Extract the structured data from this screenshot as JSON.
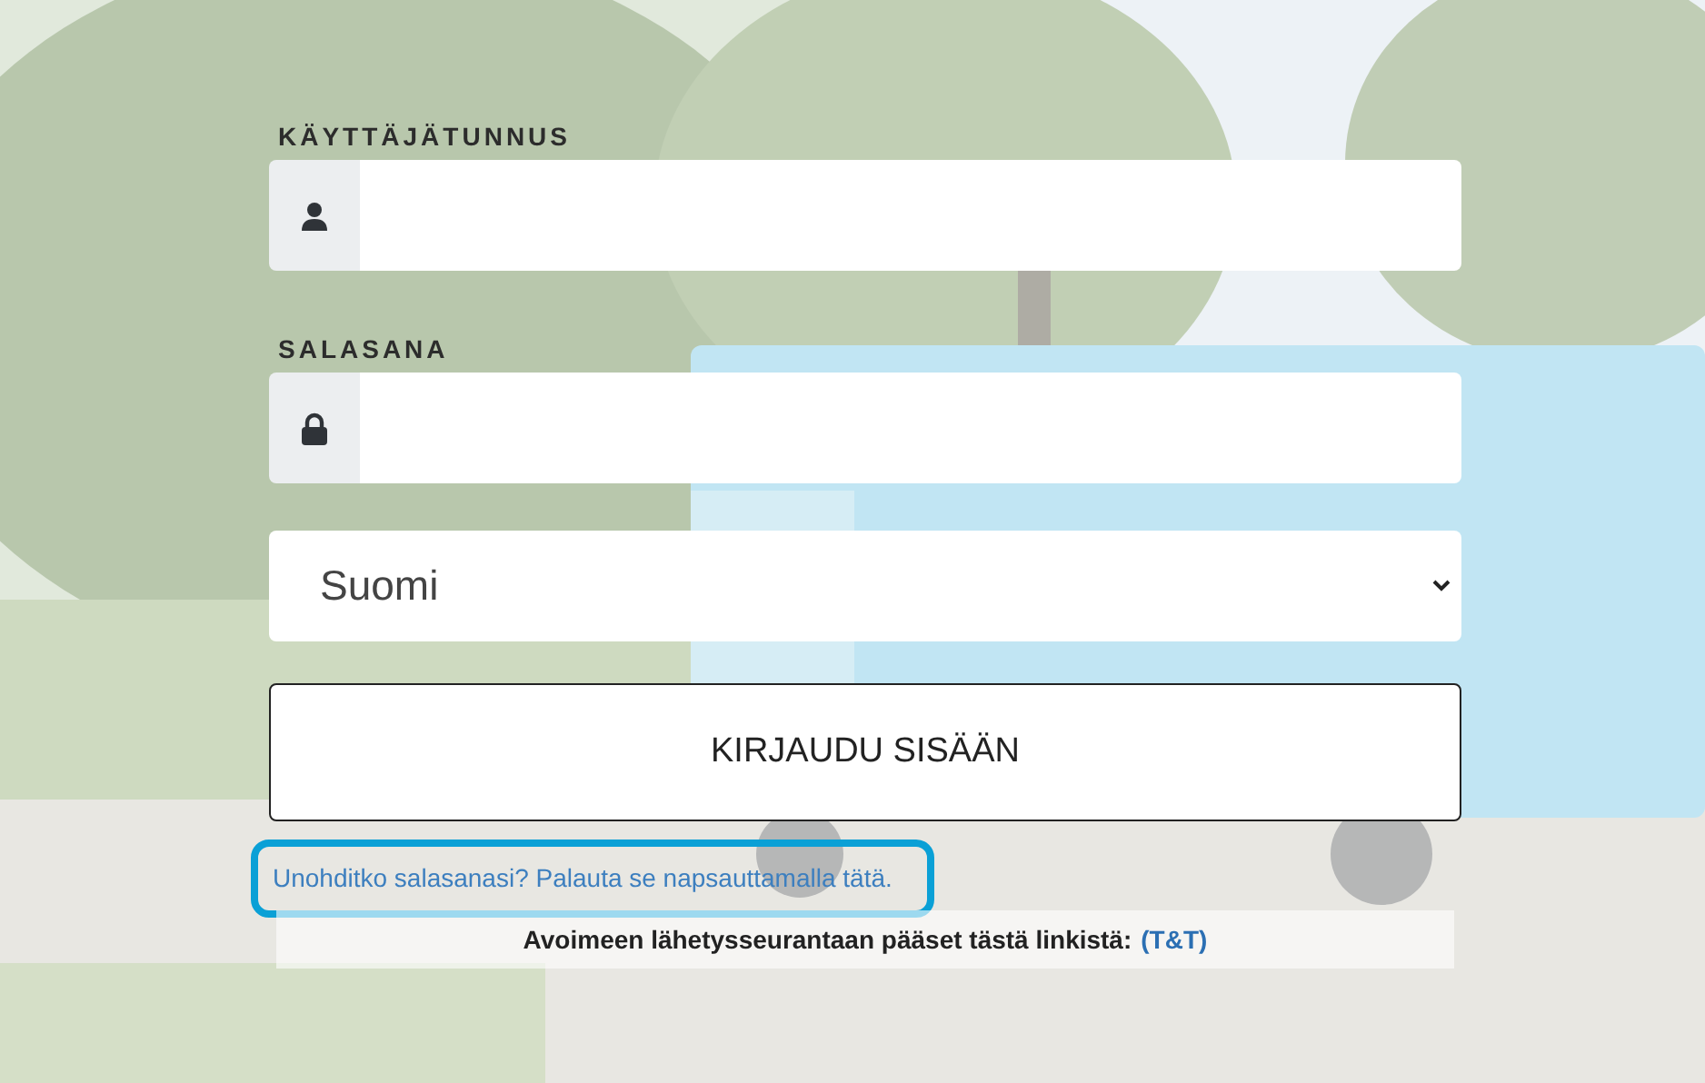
{
  "username": {
    "label": "KÄYTTÄJÄTUNNUS"
  },
  "password": {
    "label": "SALASANA"
  },
  "language": {
    "value": "Suomi"
  },
  "login_button": "KIRJAUDU SISÄÄN",
  "forgot_link": {
    "text": "Unohditko salasanasi? Palauta se napsauttamalla tätä.",
    "highlighted": true
  },
  "tracking": {
    "text": "Avoimeen lähetysseurantaan pääset tästä linkistä:",
    "link": "(T&T)"
  }
}
